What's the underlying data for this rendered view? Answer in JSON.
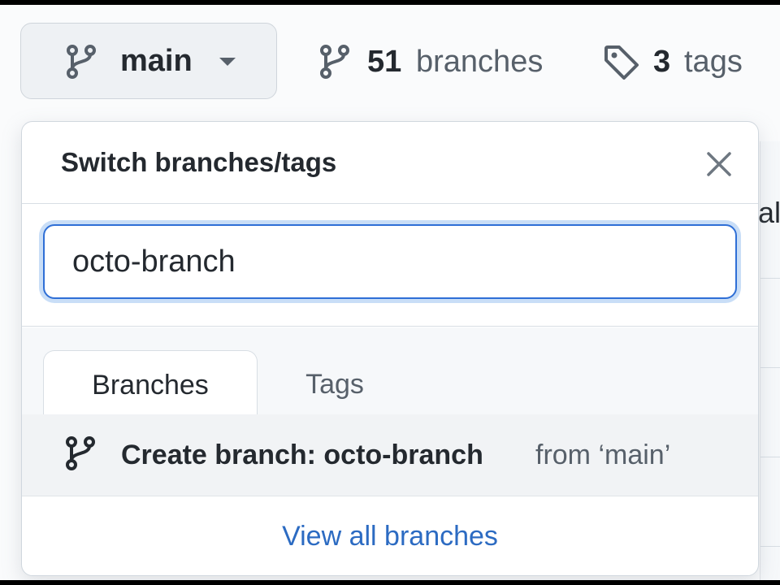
{
  "toolbar": {
    "branch_button_label": "main",
    "branches_count": "51",
    "branches_word": "branches",
    "tags_count": "3",
    "tags_word": "tags"
  },
  "dropdown": {
    "title": "Switch branches/tags",
    "filter_value": "octo-branch",
    "tabs": [
      {
        "label": "Branches",
        "selected": true
      },
      {
        "label": "Tags",
        "selected": false
      }
    ],
    "create_row": {
      "main_text": "Create branch: octo-branch",
      "from_text": "from ‘main’"
    },
    "view_all_label": "View all branches"
  },
  "background": {
    "partial_text": "al"
  },
  "icons": {
    "branch": "git-branch-icon",
    "tag": "tag-icon",
    "close": "close-icon",
    "caret": "caret-down-icon"
  },
  "colors": {
    "focus_border": "#2f6fd6",
    "link": "#2c6bc2",
    "text_primary": "#24292f",
    "text_muted": "#57606a"
  }
}
